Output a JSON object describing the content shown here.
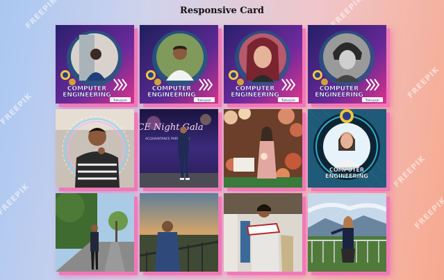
{
  "page": {
    "title": "Responsive Card"
  },
  "watermark": "FREEPIK",
  "cards": [
    {
      "type": "profile-frame",
      "title_line1": "COMPUTER",
      "title_line2": "ENGINEERING",
      "footer": "Tukuyun"
    },
    {
      "type": "profile-frame",
      "title_line1": "COMPUTER",
      "title_line2": "ENGINEERING",
      "footer": "Tukuyun"
    },
    {
      "type": "profile-frame",
      "title_line1": "COMPUTER",
      "title_line2": "ENGINEERING",
      "footer": "Tukuyun"
    },
    {
      "type": "profile-frame",
      "title_line1": "COMPUTER",
      "title_line2": "ENGINEERING",
      "footer": "Tukuyun"
    },
    {
      "type": "photo",
      "subject": "portrait-neon-circle"
    },
    {
      "type": "photo",
      "subject": "event-stage",
      "stage_text": "CE Night Gala",
      "stage_subtext": "ACQUAINTANCE PARTY 2023"
    },
    {
      "type": "photo",
      "subject": "floral-backdrop"
    },
    {
      "type": "badge-frame",
      "title_line1": "COMPUTER",
      "title_line2": "ENGINEERING"
    },
    {
      "type": "photo",
      "subject": "outdoor-street"
    },
    {
      "type": "photo",
      "subject": "sunset-balcony"
    },
    {
      "type": "photo",
      "subject": "sneaker-pose"
    },
    {
      "type": "photo",
      "subject": "mountain-view"
    }
  ]
}
